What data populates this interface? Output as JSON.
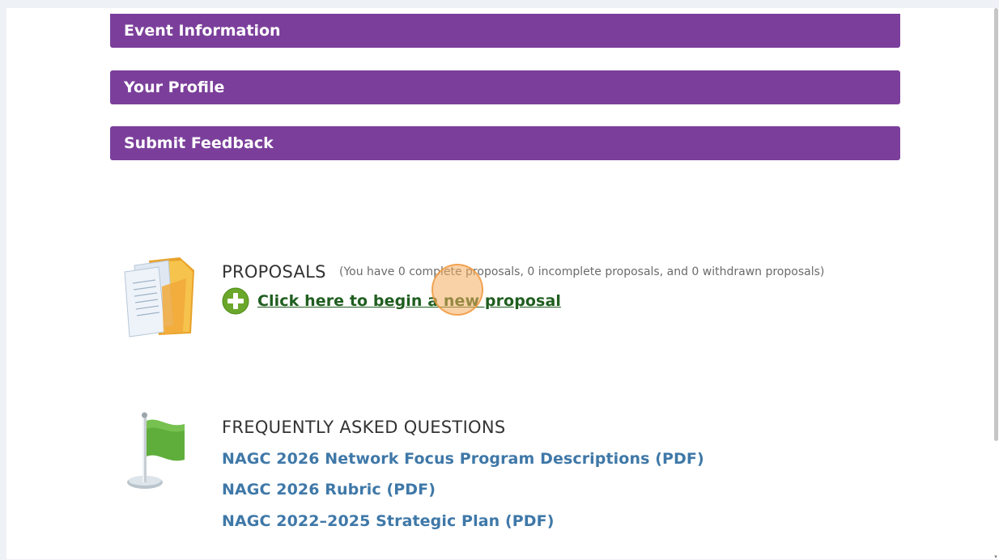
{
  "accordions": {
    "event_information": "Event Information",
    "your_profile": "Your Profile",
    "submit_feedback": "Submit Feedback"
  },
  "colors": {
    "accordion_bg": "#7b3f9b",
    "link_blue": "#3f78a8",
    "link_green": "#1f5e1f"
  },
  "proposals": {
    "title": "PROPOSALS",
    "summary": "(You have 0 complete proposals, 0 incomplete proposals, and 0 withdrawn proposals)",
    "new_link": "Click here to begin a new proposal",
    "icon": "documents-folder-icon",
    "add_icon": "add-plus-icon"
  },
  "faq": {
    "title": "FREQUENTLY ASKED QUESTIONS",
    "icon": "green-flag-icon",
    "links": [
      "NAGC 2026 Network Focus Program Descriptions (PDF)",
      "NAGC 2026 Rubric (PDF)",
      "NAGC 2022–2025 Strategic Plan (PDF)"
    ]
  }
}
